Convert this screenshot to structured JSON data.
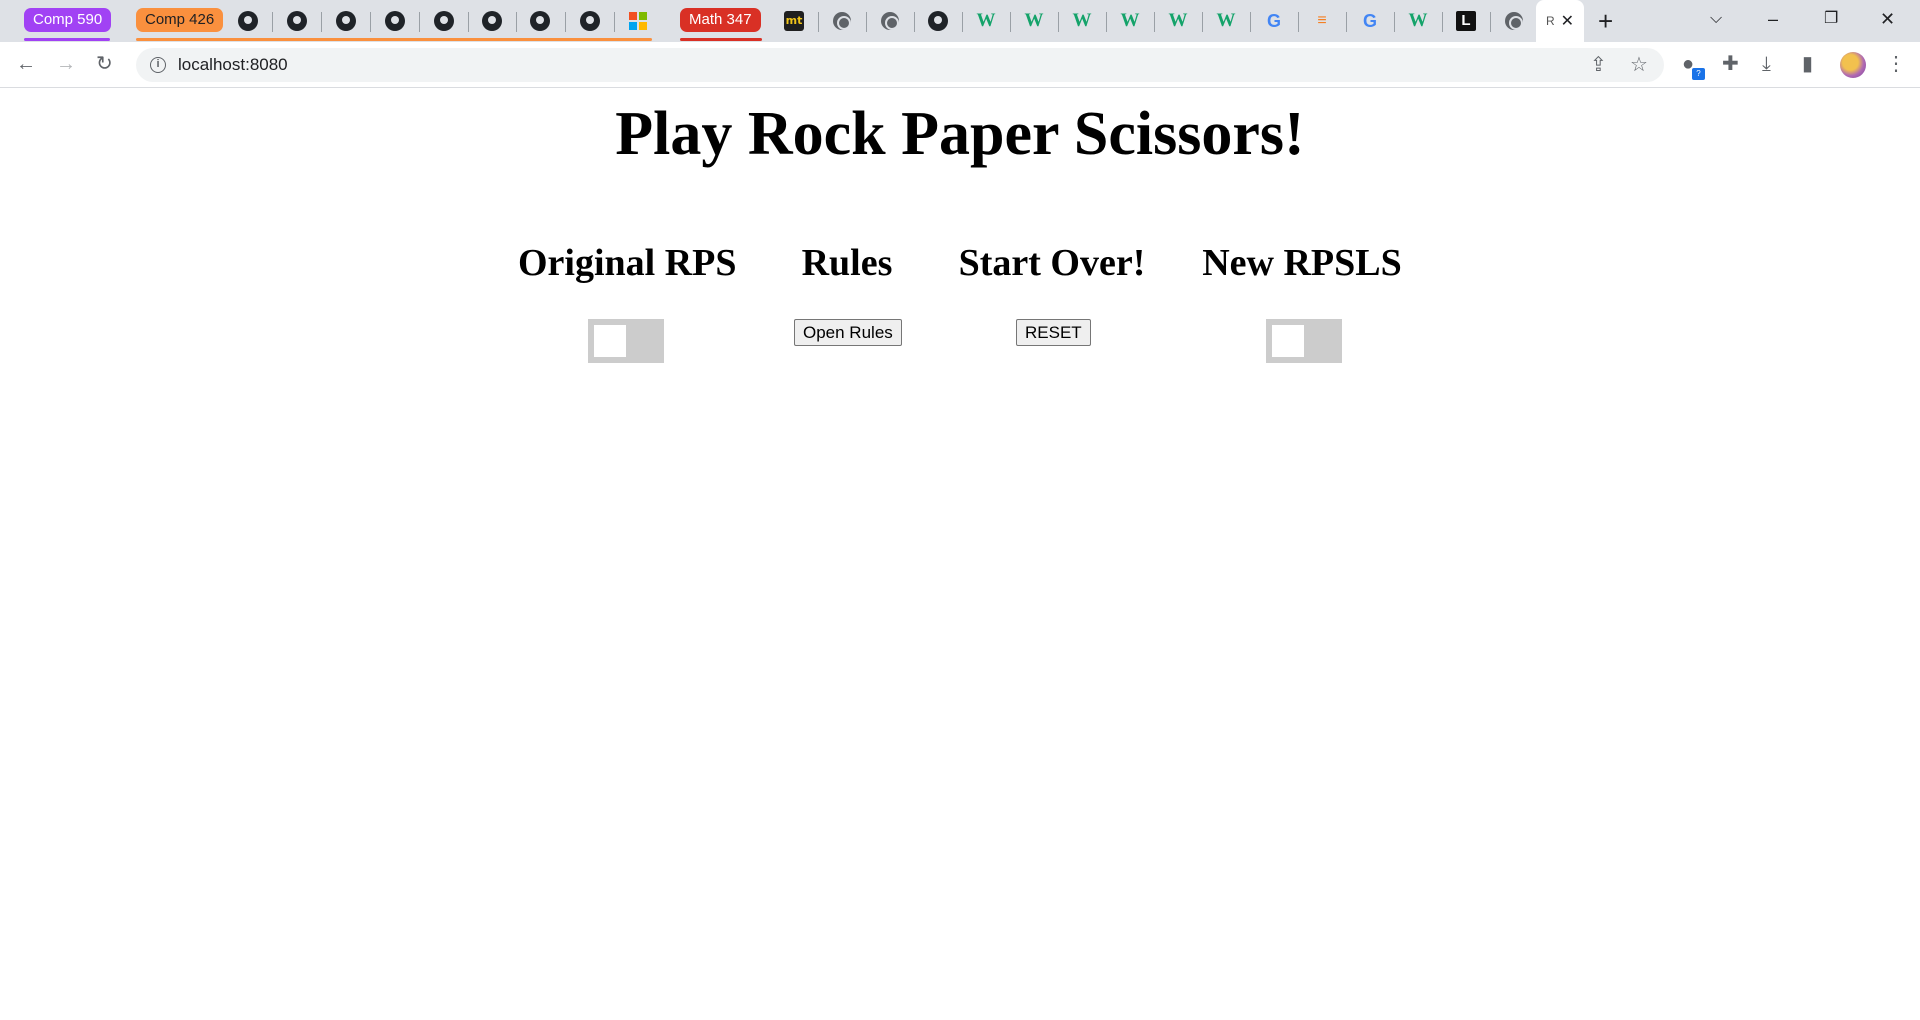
{
  "browser": {
    "tab_groups": [
      {
        "label": "Comp 590",
        "color": "#a142f4"
      },
      {
        "label": "Comp 426",
        "color": "#fa903e"
      },
      {
        "label": "Math 347",
        "color": "#d93025"
      }
    ],
    "active_tab_title": "R",
    "url": "localhost:8080"
  },
  "page": {
    "title": "Play Rock Paper Scissors!",
    "columns": {
      "original": {
        "heading": "Original RPS"
      },
      "rules": {
        "heading": "Rules",
        "button_label": "Open Rules"
      },
      "start_over": {
        "heading": "Start Over!",
        "button_label": "RESET"
      },
      "new": {
        "heading": "New RPSLS"
      }
    }
  }
}
